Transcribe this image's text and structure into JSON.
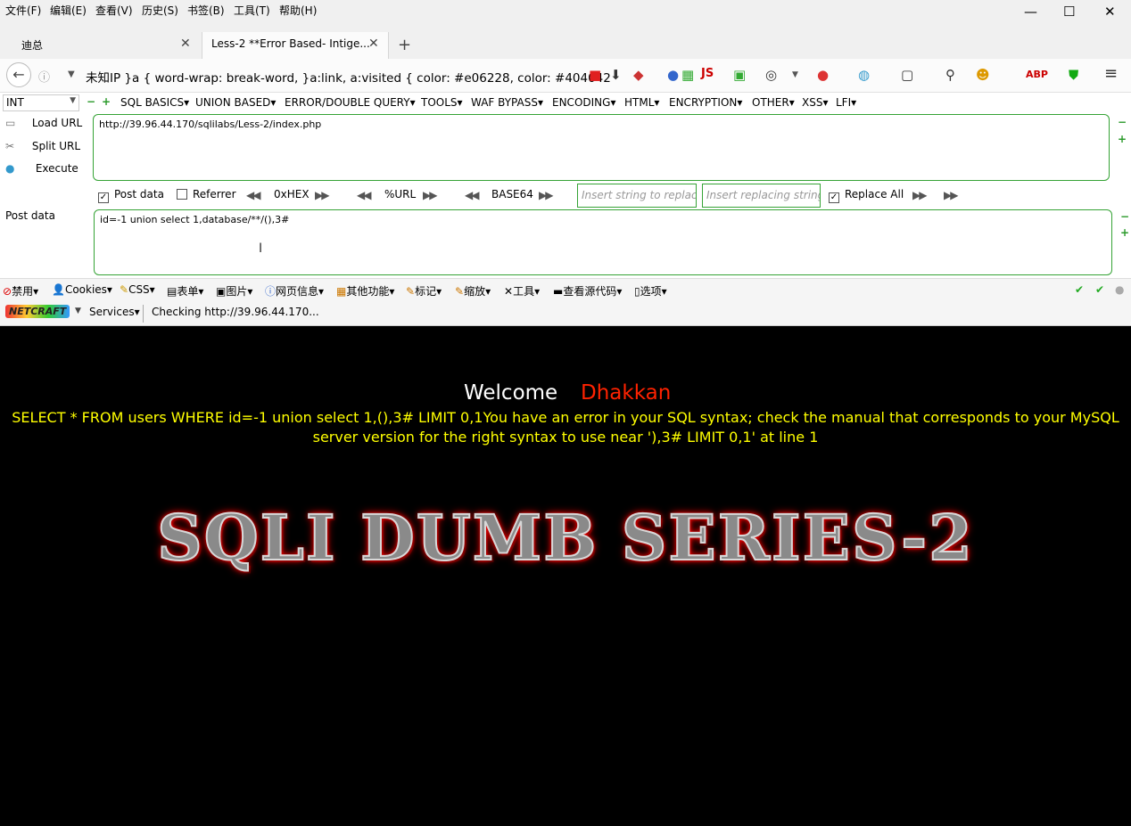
{
  "menu": [
    "文件(F)",
    "编辑(E)",
    "查看(V)",
    "历史(S)",
    "书签(B)",
    "工具(T)",
    "帮助(H)"
  ],
  "window_controls": {
    "minimize": "—",
    "maximize": "☐",
    "close": "✕"
  },
  "tabs": [
    {
      "label": "迪总",
      "active": false
    },
    {
      "label": "Less-2 **Error Based- Intige...",
      "active": true
    }
  ],
  "new_tab": "+",
  "urlbar": {
    "text": "未知IP   }a { word-wrap: break-word, }a:link, a:visited { color: #e06228, color: #404042"
  },
  "hackbar": {
    "select_value": "INT",
    "menus": [
      "SQL BASICS▾",
      "UNION BASED▾",
      "ERROR/DOUBLE QUERY▾",
      "TOOLS▾",
      "WAF BYPASS▾",
      "ENCODING▾",
      "HTML▾",
      "ENCRYPTION▾",
      "OTHER▾",
      "XSS▾",
      "LFI▾"
    ],
    "load_url": "Load URL",
    "split_url": "Split URL",
    "execute": "Execute",
    "url_value": "http://39.96.44.170/sqlilabs/Less-2/index.php",
    "post_data_checkbox": "Post data",
    "referrer_checkbox": "Referrer",
    "hex_label": "0xHEX",
    "url_enc_label": "%URL",
    "base64_label": "BASE64",
    "replace_placeholder": "Insert string to replace",
    "replacing_placeholder": "Insert replacing string",
    "replace_all": "Replace All",
    "post_data_label": "Post data",
    "post_data_value": "id=-1 union select 1,database/**/(),3#"
  },
  "devbar": [
    "禁用▾",
    "Cookies▾",
    "CSS▾",
    "表单▾",
    "图片▾",
    "网页信息▾",
    "其他功能▾",
    "标记▾",
    "缩放▾",
    "工具▾",
    "查看源代码▾",
    "选项▾"
  ],
  "netcraft": {
    "logo": "NETCRAFT",
    "services": "Services▾",
    "status": "Checking http://39.96.44.170..."
  },
  "page": {
    "welcome": "Welcome",
    "name": "Dhakkan",
    "sql_message": "SELECT * FROM users WHERE id=-1 union select 1,(),3# LIMIT 0,1You have an error in your SQL syntax; check the manual that corresponds to your MySQL server version for the right syntax to use near '),3# LIMIT 0,1' at line 1",
    "banner": "SQLI DUMB SERIES-2"
  },
  "colors": {
    "welcome": "#ffffff",
    "name": "#ff2200",
    "sql_message": "#ffff00",
    "hackbar_border": "#35a335"
  }
}
